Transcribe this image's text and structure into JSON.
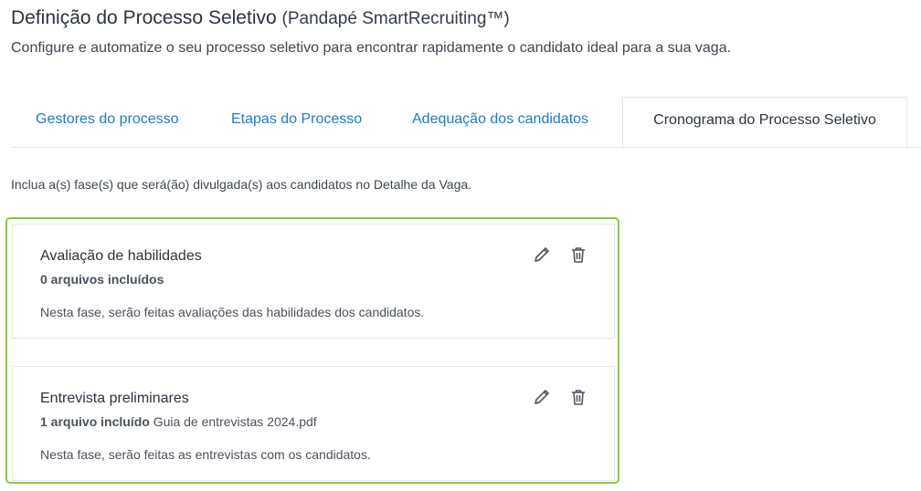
{
  "header": {
    "title": "Definição do Processo Seletivo",
    "title_suffix": "(Pandapé SmartRecruiting™)",
    "subtitle": "Configure e automatize o seu processo seletivo para encontrar rapidamente o candidato ideal para a sua vaga."
  },
  "tabs": [
    {
      "label": "Gestores do processo",
      "active": false
    },
    {
      "label": "Etapas do Processo",
      "active": false
    },
    {
      "label": "Adequação dos candidatos",
      "active": false
    },
    {
      "label": "Cronograma do Processo Seletivo",
      "active": true
    }
  ],
  "instruction": "Inclua a(s) fase(s) que será(ão) divulgada(s) aos candidatos no Detalhe da Vaga.",
  "phases": [
    {
      "name": "Avaliação de habilidades",
      "files_count": "0 arquivos incluídos",
      "file_name": "",
      "description": "Nesta fase, serão feitas avaliações das habilidades dos candidatos.",
      "edit_icon": "pencil-icon",
      "delete_icon": "trash-icon"
    },
    {
      "name": "Entrevista preliminares",
      "files_count": "1 arquivo incluído",
      "file_name": "Guia de entrevistas 2024.pdf",
      "description": "Nesta fase, serão feitas as entrevistas com os candidatos.",
      "edit_icon": "pencil-icon",
      "delete_icon": "trash-icon"
    }
  ],
  "colors": {
    "accent_link": "#1f7ac9",
    "highlight_border": "#8dc63f",
    "text_dark": "#2b3440"
  }
}
